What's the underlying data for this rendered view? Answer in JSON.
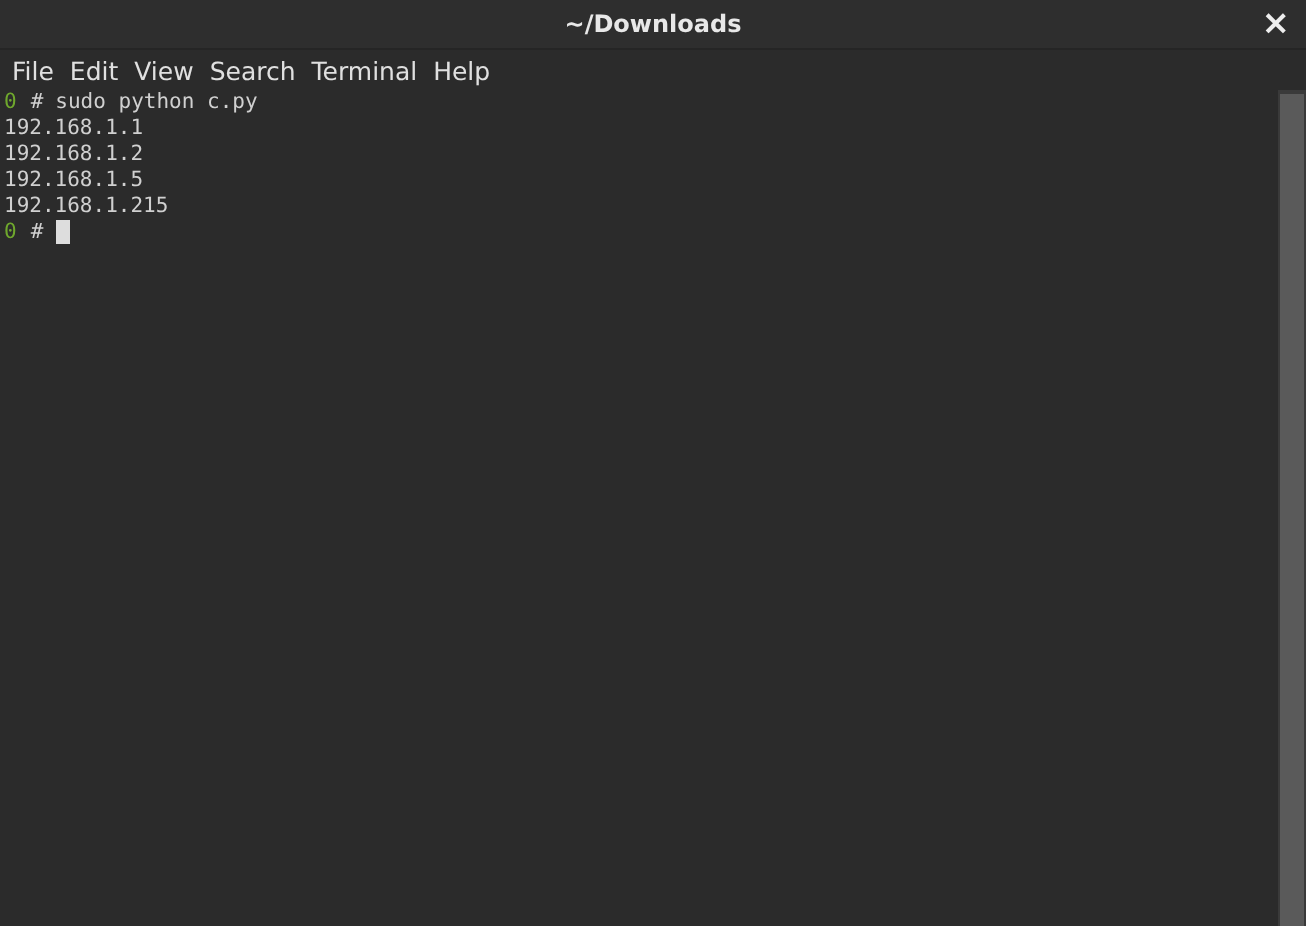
{
  "window": {
    "title": "~/Downloads",
    "close": "×"
  },
  "menu": [
    "File",
    "Edit",
    "View",
    "Search",
    "Terminal",
    "Help"
  ],
  "terminal": {
    "lines": [
      {
        "kind": "prompt",
        "status": "0",
        "symbol": "#",
        "command": "sudo python c.py",
        "cursor": false
      },
      {
        "kind": "output",
        "text": "192.168.1.1"
      },
      {
        "kind": "output",
        "text": "192.168.1.2"
      },
      {
        "kind": "output",
        "text": "192.168.1.5"
      },
      {
        "kind": "output",
        "text": "192.168.1.215"
      },
      {
        "kind": "prompt",
        "status": "0",
        "symbol": "#",
        "cursor": true
      }
    ]
  }
}
